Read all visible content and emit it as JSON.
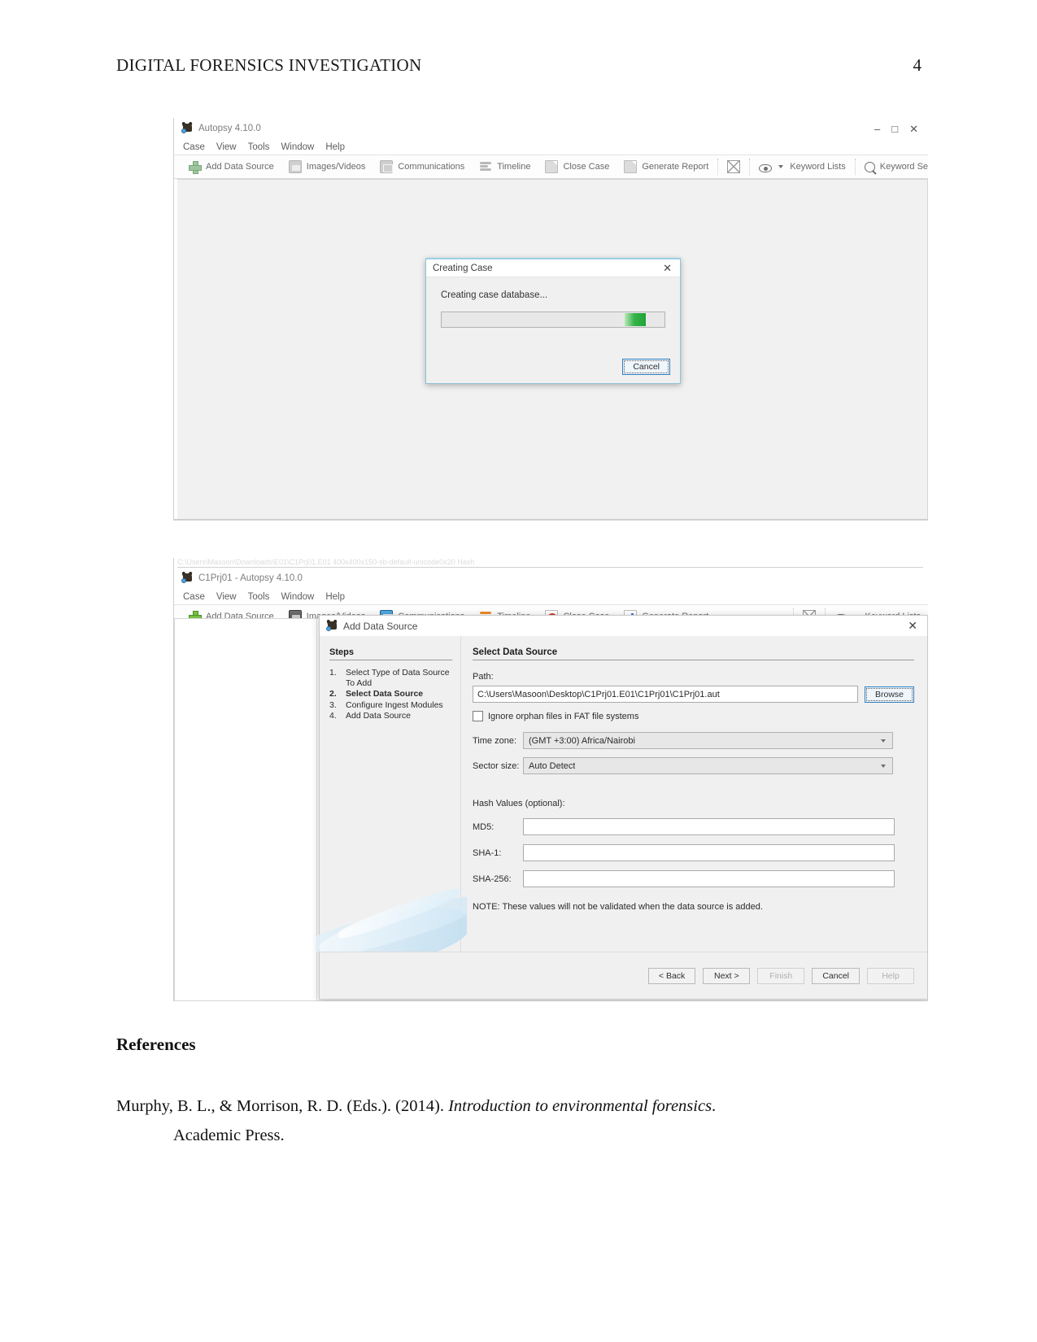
{
  "document": {
    "running_head": "DIGITAL FORENSICS INVESTIGATION",
    "page_number": "4"
  },
  "window1": {
    "title": "Autopsy 4.10.0",
    "app_icon": "autopsy-icon",
    "window_buttons": {
      "minimize": "–",
      "maximize": "□",
      "close": "✕"
    },
    "menu": [
      "Case",
      "View",
      "Tools",
      "Window",
      "Help"
    ],
    "toolbar": [
      {
        "label": "Add Data Source",
        "icon": "plus-icon"
      },
      {
        "label": "Images/Videos",
        "icon": "images-videos-icon"
      },
      {
        "label": "Communications",
        "icon": "communications-icon"
      },
      {
        "label": "Timeline",
        "icon": "timeline-icon"
      },
      {
        "label": "Close Case",
        "icon": "close-case-icon"
      },
      {
        "label": "Generate Report",
        "icon": "generate-report-icon"
      }
    ],
    "toolbar_right": {
      "mail_icon": "mail-icon",
      "keyword_lists": "Keyword Lists",
      "keyword_search": "Keyword Search"
    },
    "dialog": {
      "title": "Creating Case",
      "close_label": "✕",
      "message": "Creating case database...",
      "progress": {
        "indeterminate": true,
        "chunk_position_percent": 82,
        "color": "#37b34a"
      },
      "cancel_label": "Cancel"
    }
  },
  "window2": {
    "ghost_text": "C:\\Users\\Masoon\\Downloads\\E01\\C1Prj01.E01  400x400x150-sb-default-unicode0x20 Hash",
    "title": "C1Prj01 - Autopsy 4.10.0",
    "menu": [
      "Case",
      "View",
      "Tools",
      "Window",
      "Help"
    ],
    "toolbar": [
      {
        "label": "Add Data Source",
        "icon": "plus-icon"
      },
      {
        "label": "Images/Videos",
        "icon": "images-videos-icon"
      },
      {
        "label": "Communications",
        "icon": "communications-icon"
      },
      {
        "label": "Timeline",
        "icon": "timeline-icon"
      },
      {
        "label": "Close Case",
        "icon": "close-case-icon"
      },
      {
        "label": "Generate Report",
        "icon": "generate-report-icon"
      }
    ],
    "toolbar_right": {
      "mail_icon": "mail-icon",
      "keyword_lists": "Keyword Lists"
    },
    "wizard": {
      "title": "Add Data Source",
      "close_label": "✕",
      "steps_header": "Steps",
      "steps": [
        {
          "num": "1.",
          "label": "Select Type of Data Source To Add",
          "current": false
        },
        {
          "num": "2.",
          "label": "Select Data Source",
          "current": true
        },
        {
          "num": "3.",
          "label": "Configure Ingest Modules",
          "current": false
        },
        {
          "num": "4.",
          "label": "Add Data Source",
          "current": false
        }
      ],
      "panel_header": "Select Data Source",
      "path_label": "Path:",
      "path_value": "C:\\Users\\Masoon\\Desktop\\C1Prj01.E01\\C1Prj01\\C1Prj01.aut",
      "browse_label": "Browse",
      "ignore_orphan_label": "Ignore orphan files in FAT file systems",
      "ignore_orphan_checked": false,
      "timezone_label": "Time zone:",
      "timezone_value": "(GMT +3:00) Africa/Nairobi",
      "sector_size_label": "Sector size:",
      "sector_size_value": "Auto Detect",
      "hash_header": "Hash Values (optional):",
      "md5_label": "MD5:",
      "md5_value": "",
      "sha1_label": "SHA-1:",
      "sha1_value": "",
      "sha256_label": "SHA-256:",
      "sha256_value": "",
      "note": "NOTE: These values will not be validated when the data source is added.",
      "buttons": {
        "back": "< Back",
        "next": "Next >",
        "finish": "Finish",
        "cancel": "Cancel",
        "help": "Help"
      }
    }
  },
  "references": {
    "heading": "References",
    "entry_line1_a": "Murphy,  B.  L.,  &  Morrison,  R.  D.  (Eds.).  (2014). ",
    "entry_line1_italic": "Introduction  to  environmental  forensics",
    "entry_line1_b": ".",
    "entry_line2": "Academic Press."
  }
}
